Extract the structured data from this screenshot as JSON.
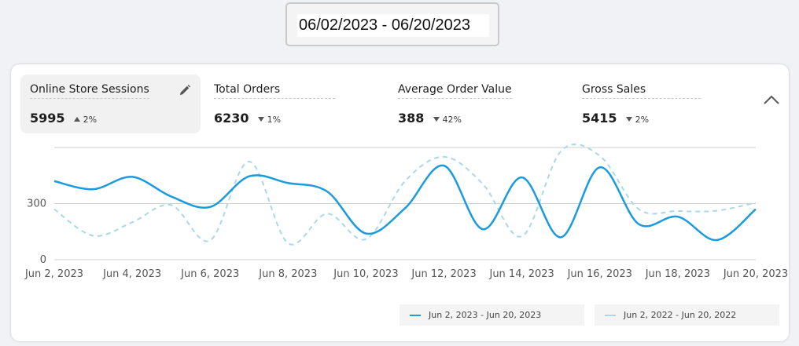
{
  "date_range": {
    "value": "06/02/2023 - 06/20/2023"
  },
  "kpis": [
    {
      "title": "Online Store Sessions",
      "value": "5995",
      "direction": "up",
      "delta": "2%",
      "active": true
    },
    {
      "title": "Total Orders",
      "value": "6230",
      "direction": "down",
      "delta": "1%",
      "active": false
    },
    {
      "title": "Average Order Value",
      "value": "388",
      "direction": "down",
      "delta": "42%",
      "active": false
    },
    {
      "title": "Gross Sales",
      "value": "5415",
      "direction": "down",
      "delta": "2%",
      "active": false
    }
  ],
  "icons": {
    "edit": "pencil-icon",
    "collapse": "chevron-up-icon"
  },
  "chart_data": {
    "type": "line",
    "x": [
      "Jun 2, 2023",
      "Jun 3, 2023",
      "Jun 4, 2023",
      "Jun 5, 2023",
      "Jun 6, 2023",
      "Jun 7, 2023",
      "Jun 8, 2023",
      "Jun 9, 2023",
      "Jun 10, 2023",
      "Jun 11, 2023",
      "Jun 12, 2023",
      "Jun 13, 2023",
      "Jun 14, 2023",
      "Jun 15, 2023",
      "Jun 16, 2023",
      "Jun 17, 2023",
      "Jun 18, 2023",
      "Jun 19, 2023",
      "Jun 20, 2023"
    ],
    "x_ticks": [
      "Jun 2, 2023",
      "Jun 4, 2023",
      "Jun 6, 2023",
      "Jun 8, 2023",
      "Jun 10, 2023",
      "Jun 12, 2023",
      "Jun 14, 2023",
      "Jun 16, 2023",
      "Jun 18, 2023",
      "Jun 20, 2023"
    ],
    "y_ticks": [
      0,
      300
    ],
    "ylim": [
      0,
      600
    ],
    "series": [
      {
        "name": "Jun 2, 2023 - Jun 20, 2023",
        "color": "#1a9be0",
        "style": "solid",
        "values": [
          420,
          377,
          443,
          338,
          282,
          446,
          410,
          365,
          140,
          275,
          503,
          163,
          440,
          120,
          494,
          190,
          230,
          105,
          270
        ]
      },
      {
        "name": "Jun 2, 2022 - Jun 20, 2022",
        "color": "#a9d8ea",
        "style": "dashed",
        "values": [
          270,
          128,
          200,
          292,
          103,
          525,
          88,
          246,
          110,
          420,
          550,
          404,
          125,
          580,
          555,
          270,
          260,
          262,
          305
        ]
      }
    ],
    "grid": true,
    "legend": "bottom-right"
  }
}
